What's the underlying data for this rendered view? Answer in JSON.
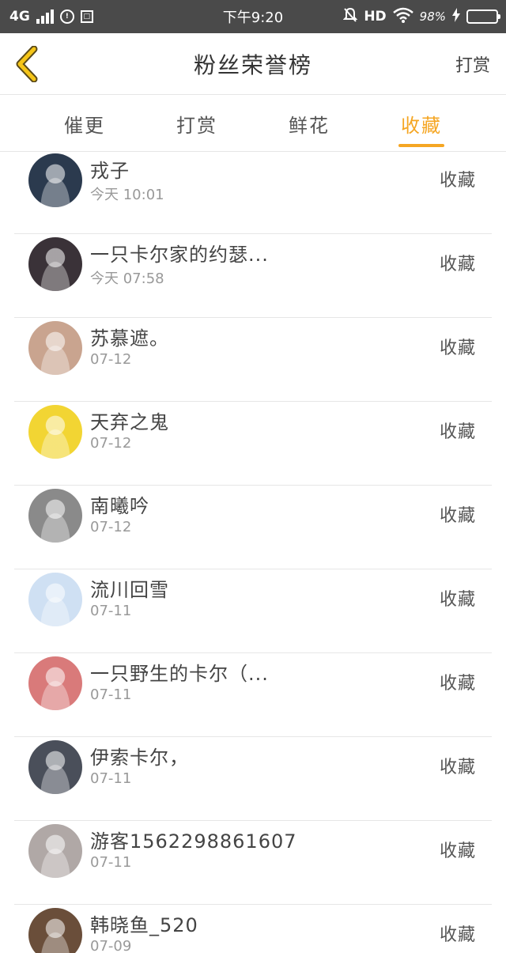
{
  "status_bar": {
    "network": "4G",
    "time": "下午9:20",
    "hd": "HD",
    "battery_pct": "98%",
    "battery_level": 0.98,
    "icons": [
      "signal-icon",
      "status-circle-icon",
      "status-square-icon",
      "mute-bell-icon",
      "wifi-icon",
      "charging-icon",
      "battery-icon"
    ]
  },
  "nav": {
    "title": "粉丝荣誉榜",
    "action": "打赏",
    "back_icon": "chevron-left-icon",
    "accent": "#f5a623"
  },
  "tabs": [
    {
      "label": "催更",
      "active": false
    },
    {
      "label": "打赏",
      "active": false
    },
    {
      "label": "鲜花",
      "active": false
    },
    {
      "label": "收藏",
      "active": true
    }
  ],
  "rows": [
    {
      "name": "戎子",
      "time": "今天 10:01",
      "action": "收藏",
      "avatar_color": "#2b3a4e"
    },
    {
      "name": "一只卡尔家的约瑟...",
      "time": "今天 07:58",
      "action": "收藏",
      "avatar_color": "#3a3238"
    },
    {
      "name": "苏慕遮。",
      "time": "07-12",
      "action": "收藏",
      "avatar_color": "#c9a48f"
    },
    {
      "name": "天弃之鬼",
      "time": "07-12",
      "action": "收藏",
      "avatar_color": "#f2d533"
    },
    {
      "name": "南曦吟",
      "time": "07-12",
      "action": "收藏",
      "avatar_color": "#8a8a8a"
    },
    {
      "name": "流川回雪",
      "time": "07-11",
      "action": "收藏",
      "avatar_color": "#cfe0f3"
    },
    {
      "name": "一只野生的卡尔（...",
      "time": "07-11",
      "action": "收藏",
      "avatar_color": "#d97a7a"
    },
    {
      "name": "伊索卡尔，",
      "time": "07-11",
      "action": "收藏",
      "avatar_color": "#4a4f5a"
    },
    {
      "name": "游客1562298861607",
      "time": "07-11",
      "action": "收藏",
      "avatar_color": "#b0a8a6"
    },
    {
      "name": "韩晓鱼_520",
      "time": "07-09",
      "action": "收藏",
      "avatar_color": "#6a4e3a"
    }
  ]
}
